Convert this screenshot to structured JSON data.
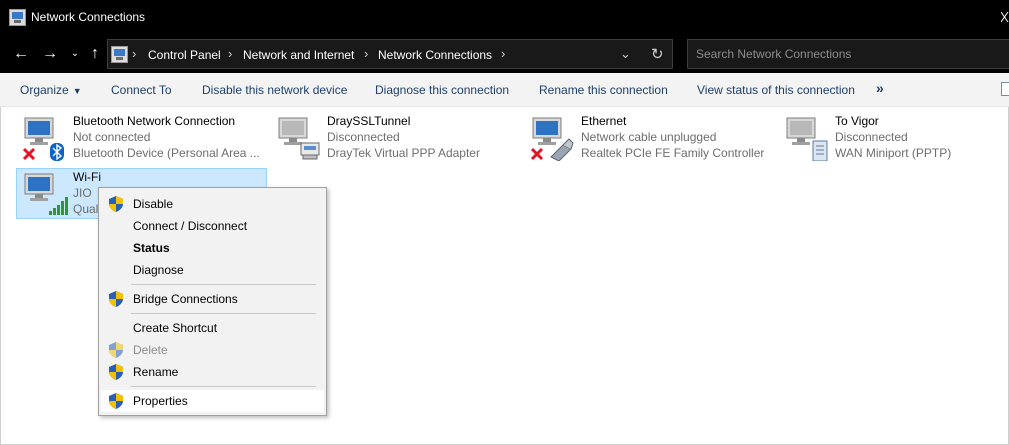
{
  "window": {
    "title": "Network Connections"
  },
  "address": {
    "crumbs": [
      "Control Panel",
      "Network and Internet",
      "Network Connections"
    ]
  },
  "search": {
    "placeholder": "Search Network Connections"
  },
  "commands": {
    "organize": "Organize",
    "connect_to": "Connect To",
    "disable": "Disable this network device",
    "diagnose": "Diagnose this connection",
    "rename": "Rename this connection",
    "view_status": "View status of this connection",
    "more": "»"
  },
  "connections": [
    {
      "name": "Bluetooth Network Connection",
      "status": "Not connected",
      "device": "Bluetooth Device (Personal Area ...",
      "icon": "bluetooth-adapter-icon",
      "state": "error"
    },
    {
      "name": "DraySSLTunnel",
      "status": "Disconnected",
      "device": "DrayTek Virtual PPP Adapter",
      "icon": "vpn-adapter-icon",
      "state": "disconnected"
    },
    {
      "name": "Ethernet",
      "status": "Network cable unplugged",
      "device": "Realtek PCIe FE Family Controller",
      "icon": "ethernet-adapter-icon",
      "state": "error"
    },
    {
      "name": "To Vigor",
      "status": "Disconnected",
      "device": "WAN Miniport (PPTP)",
      "icon": "wan-miniport-icon",
      "state": "disconnected"
    },
    {
      "name": "Wi-Fi",
      "status": "JIO",
      "device": "Qual",
      "icon": "wifi-adapter-icon",
      "state": "connected",
      "selected": true
    }
  ],
  "context_menu": {
    "items": [
      {
        "label": "Disable",
        "shield": true
      },
      {
        "label": "Connect / Disconnect",
        "shield": false
      },
      {
        "label": "Status",
        "shield": false,
        "bold": true
      },
      {
        "label": "Diagnose",
        "shield": false
      },
      {
        "label": "Bridge Connections",
        "shield": true
      },
      {
        "label": "Create Shortcut",
        "shield": false
      },
      {
        "label": "Delete",
        "shield": true,
        "disabled": true
      },
      {
        "label": "Rename",
        "shield": true
      },
      {
        "label": "Properties",
        "shield": true,
        "highlighted": true
      }
    ]
  },
  "colors": {
    "titlebar_bg": "#000000",
    "command_text": "#1e3f6b",
    "selection_bg": "#cce8ff",
    "selection_border": "#99d1ff",
    "error_red": "#e81123",
    "bluetooth_blue": "#0a64c8",
    "signal_green": "#2e9a2e"
  }
}
